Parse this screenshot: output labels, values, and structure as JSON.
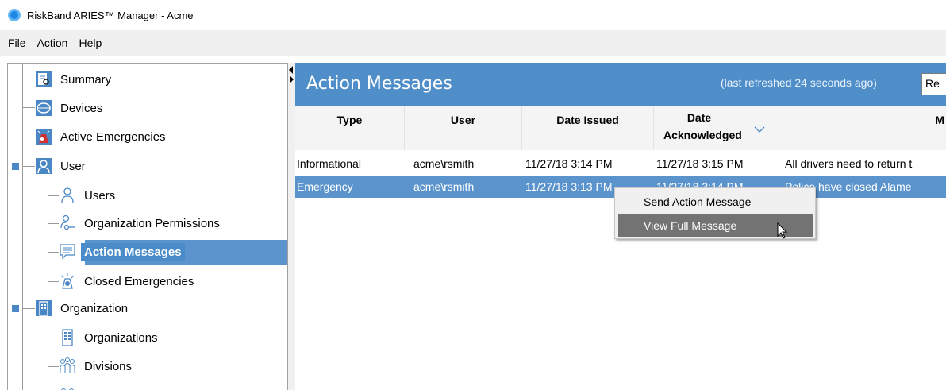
{
  "window": {
    "title": "RiskBand ARIES™ Manager - Acme"
  },
  "menubar": {
    "items": [
      "File",
      "Action",
      "Help"
    ]
  },
  "tree": {
    "items": [
      {
        "label": "Summary",
        "icon": "summary-icon"
      },
      {
        "label": "Devices",
        "icon": "devices-icon"
      },
      {
        "label": "Active Emergencies",
        "icon": "emergency-icon"
      },
      {
        "label": "User",
        "icon": "user-icon"
      },
      {
        "label": "Users",
        "icon": "users-icon"
      },
      {
        "label": "Organization Permissions",
        "icon": "user-key-icon"
      },
      {
        "label": "Action Messages",
        "icon": "message-icon",
        "selected": true
      },
      {
        "label": "Closed Emergencies",
        "icon": "closed-emergency-icon"
      },
      {
        "label": "Organization",
        "icon": "building-icon"
      },
      {
        "label": "Organizations",
        "icon": "organizations-icon"
      },
      {
        "label": "Divisions",
        "icon": "divisions-icon"
      }
    ]
  },
  "content": {
    "title": "Action Messages",
    "refresh_text": "(last refreshed 24 seconds ago)",
    "refresh_select": "Re",
    "columns": [
      "Type",
      "User",
      "Date Issued",
      "Date Acknowledged",
      "M"
    ],
    "rows": [
      {
        "type": "Informational",
        "user": "acme\\rsmith",
        "date_issued": "11/27/18 3:14 PM",
        "date_ack": "11/27/18 3:15 PM",
        "message": "All drivers need to return t"
      },
      {
        "type": "Emergency",
        "user": "acme\\rsmith",
        "date_issued": "11/27/18 3:13 PM",
        "date_ack": "11/27/18 3:14 PM",
        "message": "Police have closed Alame",
        "selected": true
      }
    ]
  },
  "context_menu": {
    "items": [
      "Send Action Message",
      "View Full Message"
    ]
  },
  "colors": {
    "accent": "#4f8ec9",
    "selection": "#5b93cc",
    "menu_hover": "#737373"
  }
}
